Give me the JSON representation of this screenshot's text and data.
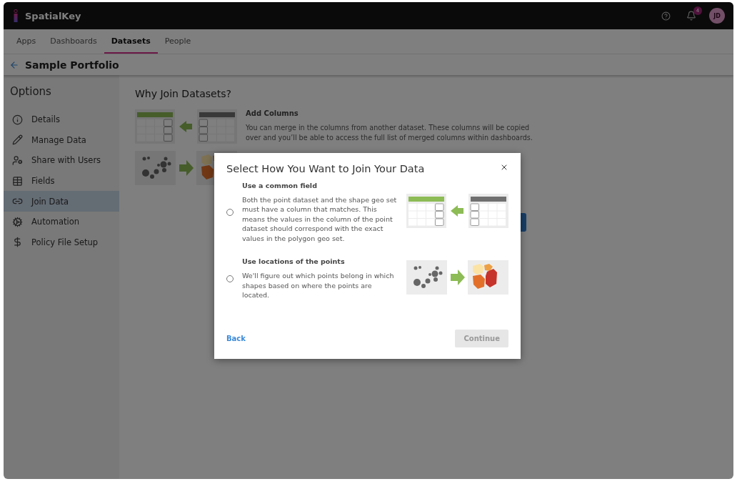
{
  "app": {
    "name": "SpatialKey",
    "notification_count": "4",
    "avatar_initials": "JD"
  },
  "nav_tabs": [
    {
      "label": "Apps",
      "selected": false
    },
    {
      "label": "Dashboards",
      "selected": false
    },
    {
      "label": "Datasets",
      "selected": true
    },
    {
      "label": "People",
      "selected": false
    }
  ],
  "page_title": "Sample Portfolio",
  "sidebar": {
    "title": "Options",
    "items": [
      {
        "label": "Details",
        "selected": false
      },
      {
        "label": "Manage Data",
        "selected": false
      },
      {
        "label": "Share with Users",
        "selected": false
      },
      {
        "label": "Fields",
        "selected": false
      },
      {
        "label": "Join Data",
        "selected": true
      },
      {
        "label": "Automation",
        "selected": false
      },
      {
        "label": "Policy File Setup",
        "selected": false
      }
    ]
  },
  "content": {
    "title": "Why Join Datasets?",
    "sections": [
      {
        "kind": "columns",
        "heading": "Add Columns",
        "text": "You can merge in the columns from another dataset. These columns will be copied over and you’ll be able to access the full list of merged columns within dashboards."
      },
      {
        "kind": "points"
      }
    ]
  },
  "modal": {
    "title": "Select How You Want to Join Your Data",
    "options": [
      {
        "kind": "columns",
        "heading": "Use a common field",
        "text": "Both the point dataset and the shape geo set must have a column that matches. This means the values in the column of the point dataset should correspond with the exact values in the polygon geo set.",
        "selected": false
      },
      {
        "kind": "points",
        "heading": "Use locations of the points",
        "text": "We'll figure out which points belong in which shapes based on where the points are located.",
        "selected": false
      }
    ],
    "back": "Back",
    "continue": {
      "label": "Continue",
      "disabled": true
    }
  }
}
